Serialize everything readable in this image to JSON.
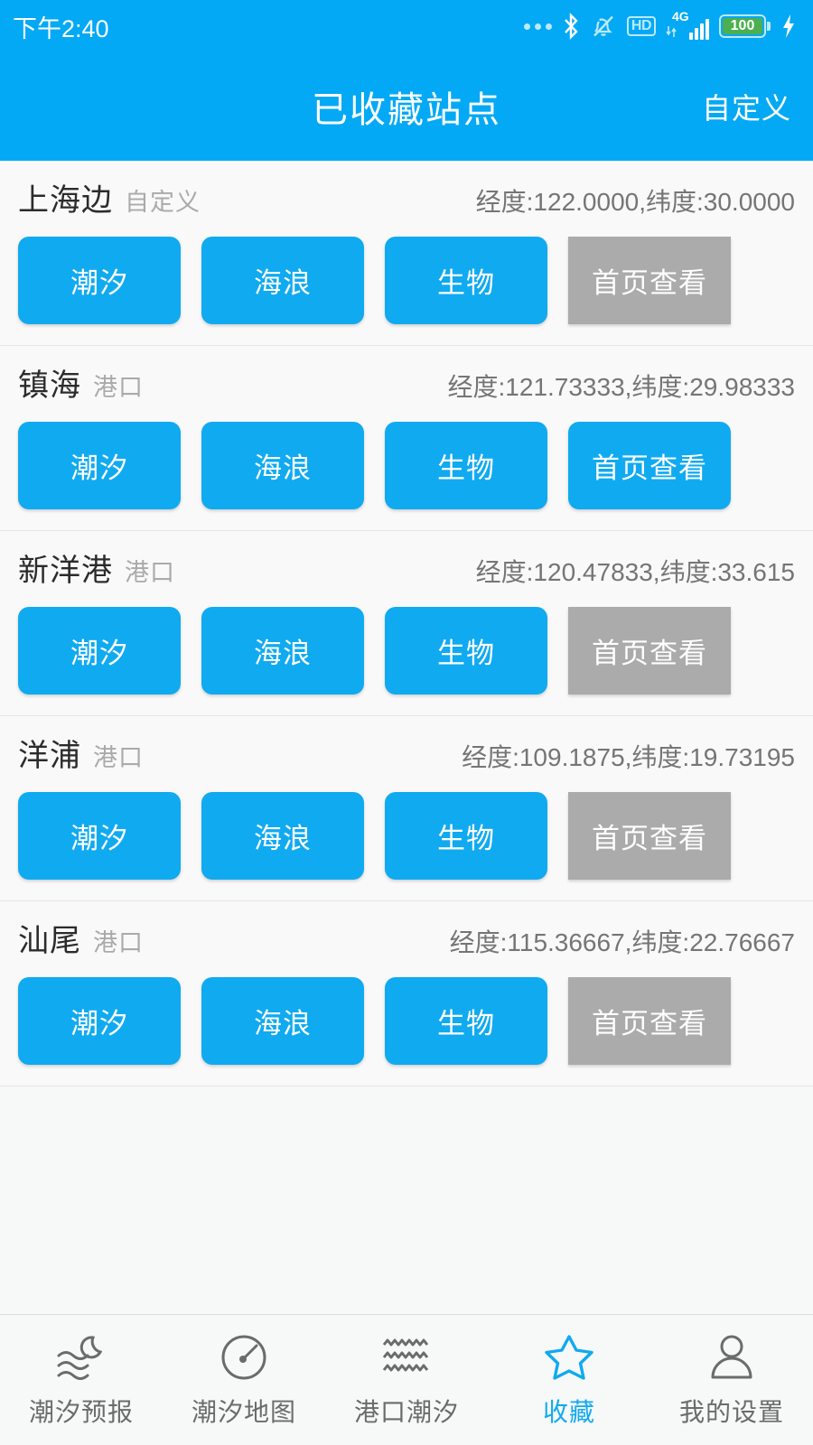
{
  "statusbar": {
    "time": "下午2:40",
    "battery_level": "100",
    "network": "4G",
    "hd_label": "HD",
    "icons": [
      "more-dots-icon",
      "bluetooth-icon",
      "bell-muted-icon",
      "hd-icon",
      "signal-4g-icon",
      "battery-icon",
      "charging-bolt-icon"
    ]
  },
  "header": {
    "title": "已收藏站点",
    "action_label": "自定义",
    "background_color": "#03a9f4"
  },
  "colors": {
    "accent": "#10aaf0",
    "disabled": "#ababab",
    "name_text": "#2b2b2b",
    "tag_text": "#aaaaaa",
    "coord_text": "#757575"
  },
  "list": {
    "rows": [
      {
        "name": "上海边",
        "tag": "自定义",
        "coords": "经度:122.0000,纬度:30.0000",
        "buttons": [
          {
            "label": "潮汐",
            "state": "enabled"
          },
          {
            "label": "海浪",
            "state": "enabled"
          },
          {
            "label": "生物",
            "state": "enabled"
          },
          {
            "label": "首页查看",
            "state": "disabled"
          }
        ]
      },
      {
        "name": "镇海",
        "tag": "港口",
        "coords": "经度:121.73333,纬度:29.98333",
        "buttons": [
          {
            "label": "潮汐",
            "state": "enabled"
          },
          {
            "label": "海浪",
            "state": "enabled"
          },
          {
            "label": "生物",
            "state": "enabled"
          },
          {
            "label": "首页查看",
            "state": "enabled"
          }
        ]
      },
      {
        "name": "新洋港",
        "tag": "港口",
        "coords": "经度:120.47833,纬度:33.615",
        "buttons": [
          {
            "label": "潮汐",
            "state": "enabled"
          },
          {
            "label": "海浪",
            "state": "enabled"
          },
          {
            "label": "生物",
            "state": "enabled"
          },
          {
            "label": "首页查看",
            "state": "disabled"
          }
        ]
      },
      {
        "name": "洋浦",
        "tag": "港口",
        "coords": "经度:109.1875,纬度:19.73195",
        "buttons": [
          {
            "label": "潮汐",
            "state": "enabled"
          },
          {
            "label": "海浪",
            "state": "enabled"
          },
          {
            "label": "生物",
            "state": "enabled"
          },
          {
            "label": "首页查看",
            "state": "disabled"
          }
        ]
      },
      {
        "name": "汕尾",
        "tag": "港口",
        "coords": "经度:115.36667,纬度:22.76667",
        "buttons": [
          {
            "label": "潮汐",
            "state": "enabled"
          },
          {
            "label": "海浪",
            "state": "enabled"
          },
          {
            "label": "生物",
            "state": "enabled"
          },
          {
            "label": "首页查看",
            "state": "disabled"
          }
        ]
      }
    ]
  },
  "tabbar": {
    "items": [
      {
        "label": "潮汐预报",
        "icon": "waves-moon-icon",
        "active": false
      },
      {
        "label": "潮汐地图",
        "icon": "gauge-icon",
        "active": false
      },
      {
        "label": "港口潮汐",
        "icon": "zigzag-waves-icon",
        "active": false
      },
      {
        "label": "收藏",
        "icon": "star-icon",
        "active": true
      },
      {
        "label": "我的设置",
        "icon": "person-icon",
        "active": false
      }
    ]
  }
}
